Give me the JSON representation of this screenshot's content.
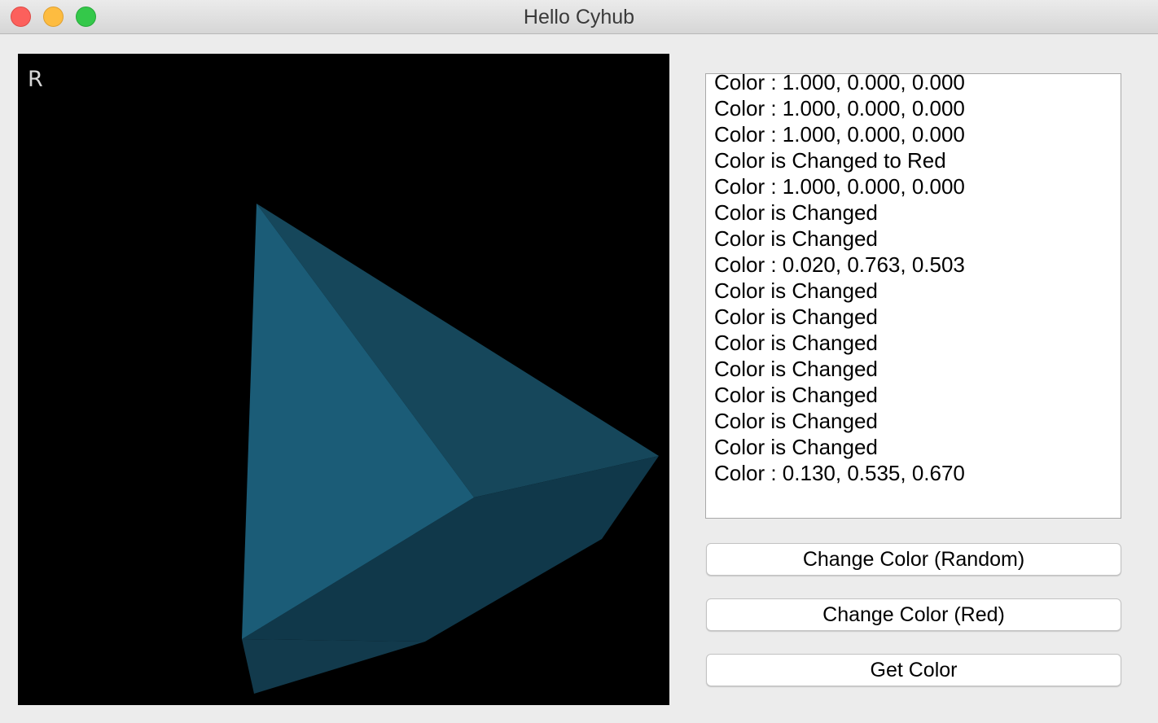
{
  "window": {
    "title": "Hello Cyhub"
  },
  "viewport": {
    "label": "R",
    "background": "#000000",
    "object_colors": {
      "light_face": "#1b5c77",
      "mid_face": "#16475b",
      "dark_face": "#10384a",
      "side_face": "#123a4c"
    }
  },
  "log": {
    "lines": [
      "Color : 1.000, 0.000, 0.000",
      "Color : 1.000, 0.000, 0.000",
      "Color : 1.000, 0.000, 0.000",
      "Color is Changed to Red",
      "Color : 1.000, 0.000, 0.000",
      "Color is Changed",
      "Color is Changed",
      "Color : 0.020, 0.763, 0.503",
      "Color is Changed",
      "Color is Changed",
      "Color is Changed",
      "Color is Changed",
      "Color is Changed",
      "Color is Changed",
      "Color is Changed",
      "Color : 0.130, 0.535, 0.670"
    ]
  },
  "buttons": {
    "random_label": "Change Color (Random)",
    "red_label": "Change Color (Red)",
    "get_label": "Get Color"
  }
}
